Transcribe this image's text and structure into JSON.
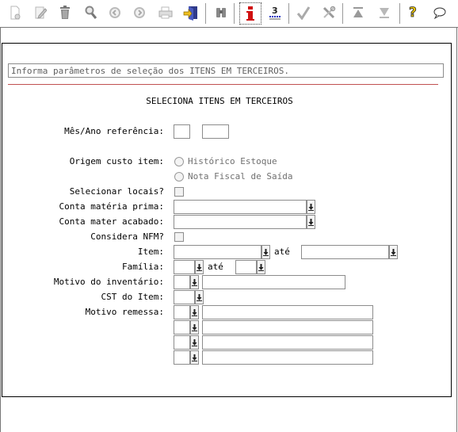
{
  "toolbar": {
    "buttons": [
      {
        "icon": "new-document-icon"
      },
      {
        "icon": "edit-icon"
      },
      {
        "icon": "trash-icon"
      },
      {
        "icon": "search-icon"
      },
      {
        "icon": "previous-icon"
      },
      {
        "icon": "next-icon"
      },
      {
        "icon": "print-icon"
      },
      {
        "icon": "exit-icon"
      },
      {
        "icon": "binoculars-icon"
      },
      {
        "icon": "info-icon"
      },
      {
        "icon": "list-number-icon"
      },
      {
        "icon": "check-icon"
      },
      {
        "icon": "tools-icon"
      },
      {
        "icon": "first-icon"
      },
      {
        "icon": "last-icon"
      },
      {
        "icon": "help-icon"
      },
      {
        "icon": "chat-icon"
      }
    ]
  },
  "form": {
    "hint": "Informa parâmetros de seleção dos ITENS EM TERCEIROS.",
    "title": "SELECIONA ITENS EM TERCEIROS",
    "labels": {
      "mes_ano": "Mês/Ano referência:",
      "origem": "Origem custo item:",
      "selecionar_locais": "Selecionar locais?",
      "conta_materia": "Conta matéria prima:",
      "conta_acabado": "Conta mater acabado:",
      "considera_nfm": "Considera NFM?",
      "item": "Item:",
      "familia": "Família:",
      "motivo_inventario": "Motivo do inventário:",
      "cst": "CST do Item:",
      "motivo_remessa": "Motivo remessa:"
    },
    "origem_options": [
      "Histórico Estoque",
      "Nota Fiscal de Saída"
    ],
    "ate": "até"
  }
}
